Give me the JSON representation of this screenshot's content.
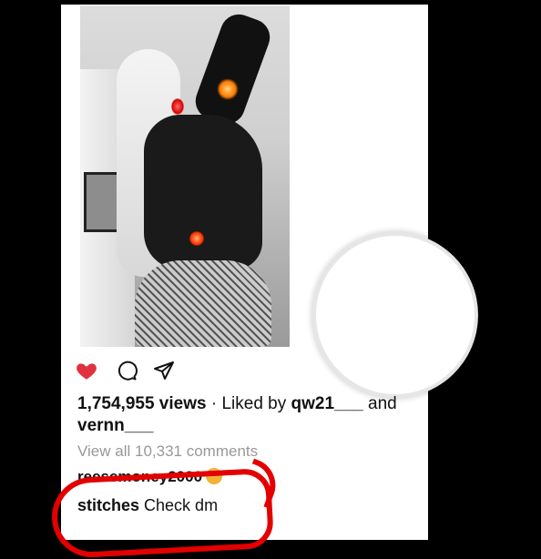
{
  "post": {
    "views_count": "1,754,955 views",
    "liked_by_prefix": " · Liked by ",
    "liked_by_user": "qw21___",
    "liked_by_suffix": " and",
    "liked_by_second": "vernn___",
    "view_all_comments": "View all 10,331 comments",
    "comment_preview": "reesemoney2000",
    "main_comment_user": "stitches",
    "main_comment_text": " Check dm"
  },
  "icons": {
    "like": "heart-icon",
    "comment": "comment-icon",
    "share": "share-icon"
  },
  "colors": {
    "like": "#e0323e",
    "annotation": "#e30000"
  }
}
